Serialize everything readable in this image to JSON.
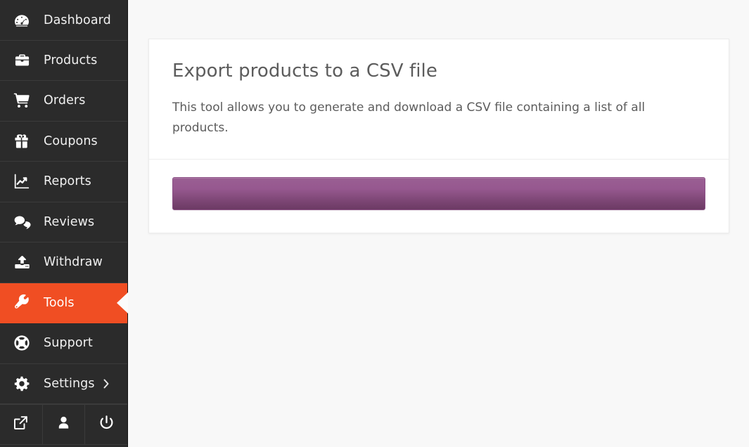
{
  "sidebar": {
    "items": [
      {
        "label": "Dashboard",
        "icon": "dashboard-gauge-icon",
        "active": false,
        "chevron": false
      },
      {
        "label": "Products",
        "icon": "briefcase-icon",
        "active": false,
        "chevron": false
      },
      {
        "label": "Orders",
        "icon": "shopping-cart-icon",
        "active": false,
        "chevron": false
      },
      {
        "label": "Coupons",
        "icon": "gift-icon",
        "active": false,
        "chevron": false
      },
      {
        "label": "Reports",
        "icon": "chart-line-icon",
        "active": false,
        "chevron": false
      },
      {
        "label": "Reviews",
        "icon": "comments-icon",
        "active": false,
        "chevron": false
      },
      {
        "label": "Withdraw",
        "icon": "upload-icon",
        "active": false,
        "chevron": false
      },
      {
        "label": "Tools",
        "icon": "wrench-icon",
        "active": true,
        "chevron": false
      },
      {
        "label": "Support",
        "icon": "life-ring-icon",
        "active": false,
        "chevron": false
      },
      {
        "label": "Settings",
        "icon": "gear-icon",
        "active": false,
        "chevron": true
      }
    ],
    "footer_buttons": [
      {
        "icon": "external-link-icon"
      },
      {
        "icon": "user-icon"
      },
      {
        "icon": "power-off-icon"
      }
    ],
    "colors": {
      "background": "#2b2b2b",
      "separator": "#3b3b3b",
      "active_background": "#f04e23",
      "text": "#f0f0f0"
    }
  },
  "card": {
    "title": "Export products to a CSV file",
    "description": "This tool allows you to generate and download a CSV file containing a list of all products.",
    "export_button_label": "",
    "colors": {
      "page_background": "#f8f8f8",
      "card_background": "#ffffff",
      "border": "#ececec",
      "title_text": "#5c5c5c",
      "button_gradient_top": "#96588f",
      "button_gradient_bottom": "#6c3a64",
      "button_border": "#8d5287"
    }
  }
}
